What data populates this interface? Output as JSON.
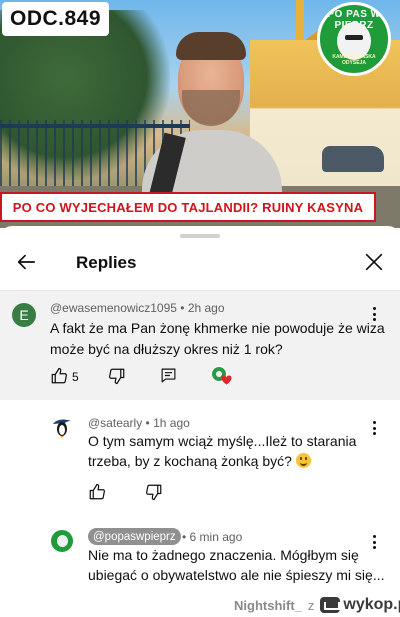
{
  "video": {
    "episode_badge": "ODC.849",
    "banner_title": "PO CO WYJECHAŁEM DO TAJLANDII? RUINY KASYNA",
    "logo_text_top": "PO PAS W PIEPRZ",
    "logo_text_bottom": "KAMBODŻAŃSKA ODYSEJA"
  },
  "sheet": {
    "title": "Replies",
    "back_icon": "arrow-left-icon",
    "close_icon": "close-icon"
  },
  "main_comment": {
    "avatar_letter": "E",
    "handle": "@ewasemenowicz1095",
    "time": "2h ago",
    "text_line1": "A fakt że ma Pan żonę khmerke nie powoduje że wiza",
    "text_line2": "może być na dłuższy okres niż 1 rok?",
    "like_count": "5"
  },
  "replies": [
    {
      "handle": "@satearly",
      "time": "1h ago",
      "text_line1": "O tym samym wciąż myślę...Ileż to starania",
      "text_line2": "trzeba, by z kochaną żonką być?"
    },
    {
      "handle": "@popaswpieprz",
      "time": "6 min ago",
      "text_line1": "Nie ma to żadnego znaczenia. Mógłbym się",
      "text_line2": "ubiegać o obywatelstwo ale nie śpieszy mi się..."
    }
  ],
  "watermark": {
    "user": "Nightshift_",
    "z": "z",
    "site": "wykop.pl"
  },
  "colors": {
    "banner_red": "#d3121a",
    "channel_green": "#1f9b3a",
    "comment_bg": "#f2f2f2",
    "heart_red": "#e0242b"
  }
}
